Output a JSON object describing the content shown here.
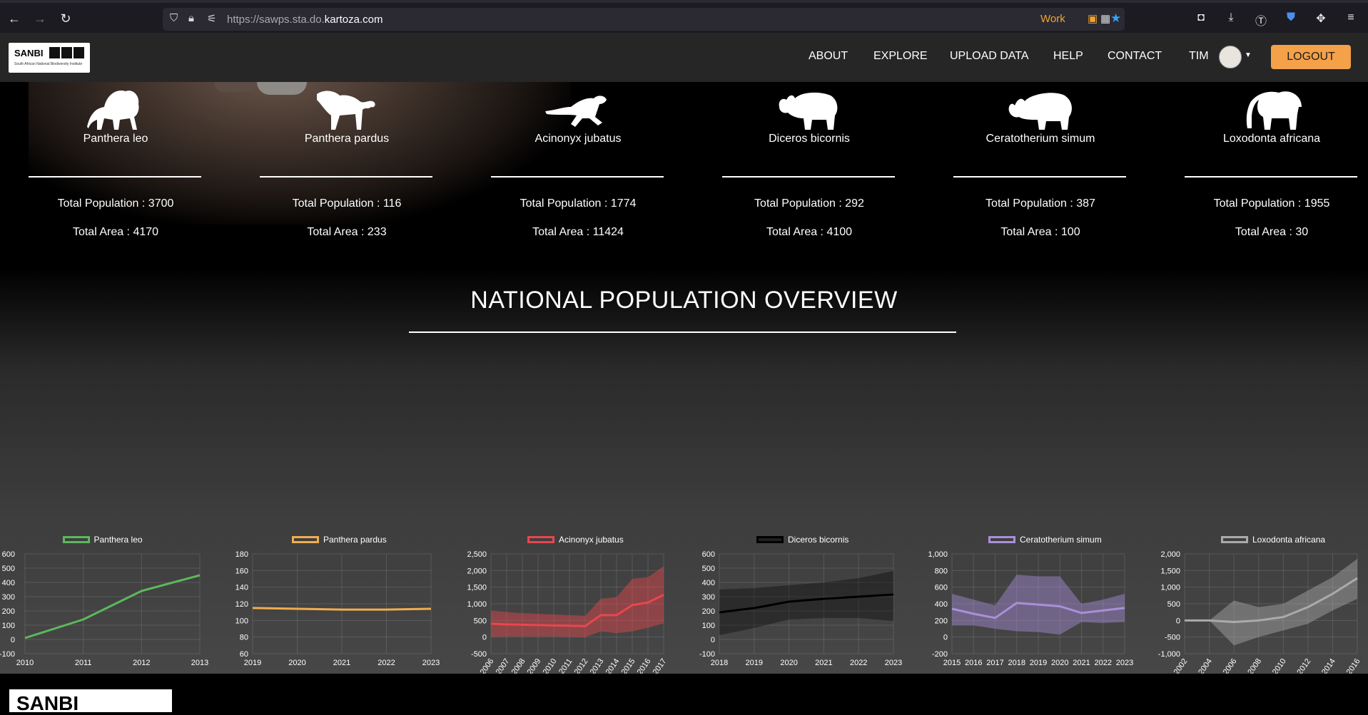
{
  "browser": {
    "url_prefix": "https://sawps.sta.do.",
    "url_host": "kartoza.com",
    "container_label": "Work"
  },
  "header": {
    "logo_title": "SANBI",
    "logo_subtitle": "South African National Biodiversity Institute",
    "nav": [
      "ABOUT",
      "EXPLORE",
      "UPLOAD DATA",
      "HELP",
      "CONTACT"
    ],
    "user": "TIM",
    "logout": "LOGOUT"
  },
  "overview": {
    "title": "NATIONAL POPULATION OVERVIEW",
    "pop_label": "Total Population : ",
    "area_label": "Total Area : "
  },
  "species": [
    {
      "name": "Panthera leo",
      "population": "3700",
      "area": "4170",
      "color": "#5cb85c",
      "icon": "lion-icon"
    },
    {
      "name": "Panthera pardus",
      "population": "116",
      "area": "233",
      "color": "#f0ad4e",
      "icon": "leopard-icon"
    },
    {
      "name": "Acinonyx jubatus",
      "population": "1774",
      "area": "11424",
      "color": "#e8464e",
      "icon": "cheetah-icon"
    },
    {
      "name": "Diceros bicornis",
      "population": "292",
      "area": "4100",
      "color": "#000000",
      "icon": "black-rhino-icon"
    },
    {
      "name": "Ceratotherium simum",
      "population": "387",
      "area": "100",
      "color": "#a98fd9",
      "icon": "white-rhino-icon"
    },
    {
      "name": "Loxodonta africana",
      "population": "1955",
      "area": "30",
      "color": "#aaaaaa",
      "icon": "elephant-icon"
    }
  ],
  "footer": {
    "logo_text": "SANBI"
  },
  "chart_data": [
    {
      "type": "line",
      "series_name": "Panthera leo",
      "x": [
        "2010",
        "2011",
        "2012",
        "2013"
      ],
      "values": [
        10,
        140,
        340,
        450
      ],
      "band": null,
      "yticks": [
        600,
        500,
        400,
        300,
        200,
        100,
        0,
        -100
      ],
      "ylim": [
        -100,
        600
      ],
      "x_rotated": false,
      "grid": true,
      "legend": "top"
    },
    {
      "type": "line",
      "series_name": "Panthera pardus",
      "x": [
        "2019",
        "2020",
        "2021",
        "2022",
        "2023"
      ],
      "values": [
        115,
        114,
        113,
        113,
        114
      ],
      "band": null,
      "yticks": [
        180,
        160,
        140,
        120,
        100,
        80,
        60
      ],
      "ylim": [
        60,
        180
      ],
      "x_rotated": false,
      "grid": true,
      "legend": "top"
    },
    {
      "type": "area",
      "series_name": "Acinonyx jubatus",
      "x": [
        "2006",
        "2007",
        "2008",
        "2009",
        "2010",
        "2011",
        "2012",
        "2013",
        "2014",
        "2015",
        "2016",
        "2017"
      ],
      "values": [
        400,
        380,
        370,
        360,
        350,
        340,
        330,
        660,
        660,
        960,
        1040,
        1270
      ],
      "band": {
        "upper": [
          800,
          750,
          720,
          700,
          680,
          660,
          640,
          1150,
          1200,
          1750,
          1800,
          2130
        ],
        "lower": [
          0,
          20,
          20,
          20,
          20,
          10,
          0,
          170,
          120,
          170,
          280,
          410
        ]
      },
      "yticks": [
        2500,
        2000,
        1500,
        1000,
        500,
        0,
        -500
      ],
      "ylim": [
        -500,
        2500
      ],
      "x_rotated": true,
      "grid": true,
      "legend": "top"
    },
    {
      "type": "area",
      "series_name": "Diceros bicornis",
      "x": [
        "2018",
        "2019",
        "2020",
        "2021",
        "2022",
        "2023"
      ],
      "values": [
        190,
        220,
        265,
        285,
        300,
        315
      ],
      "band": {
        "upper": [
          350,
          360,
          380,
          400,
          430,
          480
        ],
        "lower": [
          30,
          80,
          140,
          150,
          150,
          130
        ]
      },
      "yticks": [
        600,
        500,
        400,
        300,
        200,
        100,
        0,
        -100
      ],
      "ylim": [
        -100,
        600
      ],
      "x_rotated": false,
      "grid": true,
      "legend": "top"
    },
    {
      "type": "area",
      "series_name": "Ceratotherium simum",
      "x": [
        "2015",
        "2016",
        "2017",
        "2018",
        "2019",
        "2020",
        "2021",
        "2022",
        "2023"
      ],
      "values": [
        340,
        280,
        230,
        410,
        390,
        370,
        290,
        320,
        350
      ],
      "band": {
        "upper": [
          520,
          450,
          380,
          750,
          730,
          730,
          400,
          450,
          520
        ],
        "lower": [
          140,
          140,
          100,
          70,
          60,
          30,
          180,
          170,
          180
        ]
      },
      "yticks": [
        1000,
        800,
        600,
        400,
        200,
        0,
        -200
      ],
      "ylim": [
        -200,
        1000
      ],
      "x_rotated": false,
      "grid": true,
      "legend": "top"
    },
    {
      "type": "area",
      "series_name": "Loxodonta africana",
      "x": [
        "2002",
        "2004",
        "2006",
        "2008",
        "2010",
        "2012",
        "2014",
        "2016"
      ],
      "values": [
        0,
        0,
        -50,
        0,
        100,
        400,
        800,
        1270
      ],
      "band": {
        "upper": [
          0,
          0,
          600,
          400,
          500,
          900,
          1300,
          1850
        ],
        "lower": [
          0,
          0,
          -750,
          -500,
          -300,
          -100,
          300,
          650
        ]
      },
      "yticks": [
        2000,
        1500,
        1000,
        500,
        0,
        -500,
        -1000
      ],
      "ylim": [
        -1000,
        2000
      ],
      "x_rotated": true,
      "grid": true,
      "legend": "top"
    }
  ]
}
